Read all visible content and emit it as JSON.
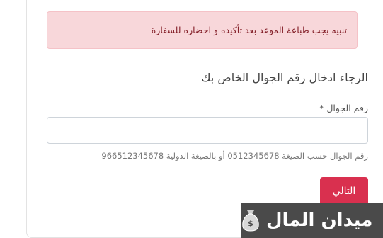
{
  "alert": {
    "text": "تنبيه يجب طباعة الموعد بعد تأكيده و احضاره للسفارة"
  },
  "form": {
    "heading": "الرجاء ادخال رقم الجوال الخاص بك",
    "phone_label": "رقم الجوال",
    "required_mark": "*",
    "phone_value": "",
    "phone_help": "رقم الجوال حسب الصيغة 0512345678 أو بالصيغة الدولية 966512345678",
    "next_label": "التالي"
  },
  "watermark": {
    "text": "ميدان المال",
    "logo_icon": "money-bag-icon"
  },
  "colors": {
    "alert_bg": "#f8d7da",
    "alert_text": "#842029",
    "primary_button": "#d9304f",
    "watermark_bg": "#4a4a4a"
  }
}
